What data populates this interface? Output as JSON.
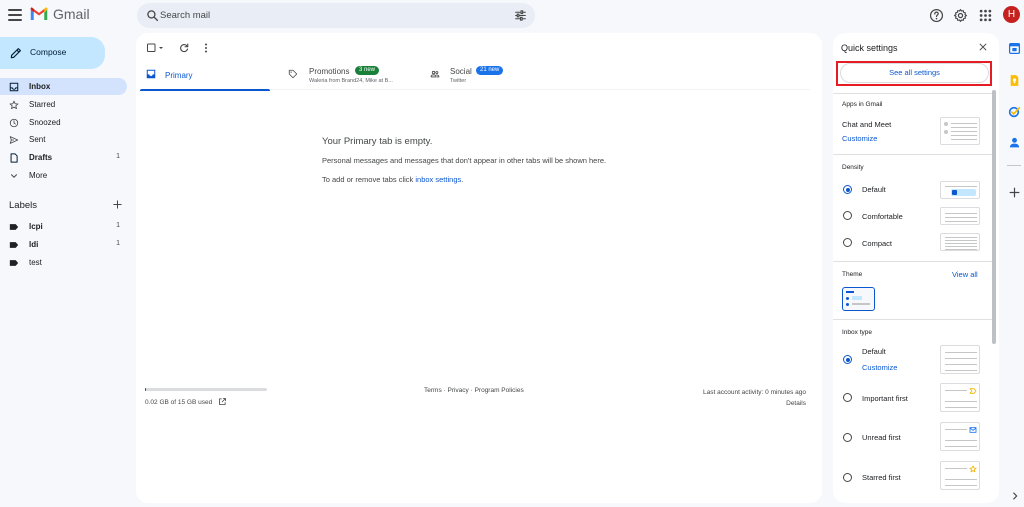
{
  "app": {
    "name": "Gmail"
  },
  "search": {
    "placeholder": "Search mail"
  },
  "compose_label": "Compose",
  "avatar_letter": "H",
  "nav": [
    {
      "label": "Inbox",
      "count": ""
    },
    {
      "label": "Starred",
      "count": ""
    },
    {
      "label": "Snoozed",
      "count": ""
    },
    {
      "label": "Sent",
      "count": ""
    },
    {
      "label": "Drafts",
      "count": "1"
    },
    {
      "label": "More",
      "count": ""
    }
  ],
  "labels_header": "Labels",
  "labels": [
    {
      "label": "lcpi",
      "count": "1"
    },
    {
      "label": "ldi",
      "count": "1"
    },
    {
      "label": "test",
      "count": ""
    }
  ],
  "tabs": [
    {
      "label": "Primary",
      "badge": "",
      "sub": ""
    },
    {
      "label": "Promotions",
      "badge": "3 new",
      "sub": "Waleria from Brand24, Mike at B..."
    },
    {
      "label": "Social",
      "badge": "21 new",
      "sub": "Twitter"
    }
  ],
  "empty_state": {
    "title": "Your Primary tab is empty.",
    "description": "Personal messages and messages that don't appear in other tabs will be shown here.",
    "tabs_prefix": "To add or remove tabs click ",
    "tabs_link": "inbox settings",
    "tabs_suffix": "."
  },
  "storage": {
    "text": "0.02 GB of 15 GB used",
    "used_fraction": 0.0013
  },
  "footer": {
    "terms": "Terms",
    "privacy": "Privacy",
    "policies": "Program Policies",
    "sep": " · "
  },
  "activity": {
    "text": "Last account activity: 0 minutes ago",
    "details": "Details"
  },
  "quick_settings": {
    "title": "Quick settings",
    "see_all": "See all settings",
    "apps_header": "Apps in Gmail",
    "chat_meet": "Chat and Meet",
    "customize": "Customize",
    "density_header": "Density",
    "density": [
      {
        "label": "Default",
        "selected": true
      },
      {
        "label": "Comfortable",
        "selected": false
      },
      {
        "label": "Compact",
        "selected": false
      }
    ],
    "theme_header": "Theme",
    "view_all": "View all",
    "inbox_type_header": "Inbox type",
    "inbox_types": [
      {
        "label": "Default",
        "selected": true
      },
      {
        "label": "Important first",
        "selected": false
      },
      {
        "label": "Unread first",
        "selected": false
      },
      {
        "label": "Starred first",
        "selected": false
      }
    ]
  },
  "colors": {
    "accent": "#0b57d0",
    "compose_bg": "#c2e7ff",
    "active_nav": "#d3e3fd",
    "highlight": "#e51c23",
    "promotions_badge": "#188038",
    "social_badge": "#1a73e8"
  }
}
